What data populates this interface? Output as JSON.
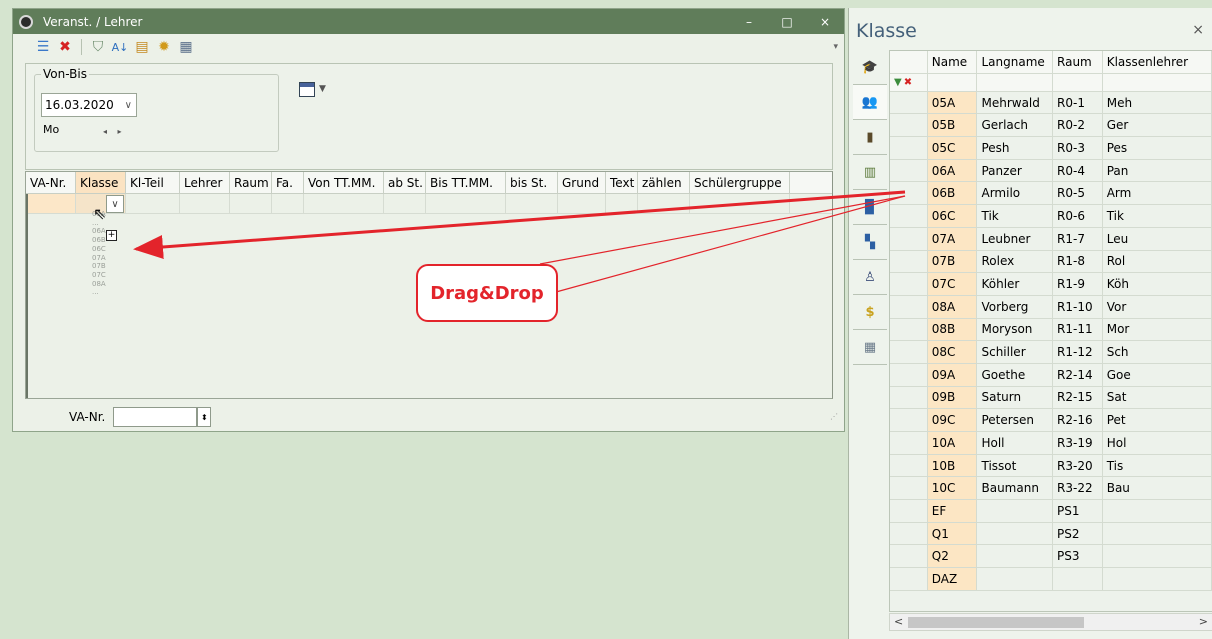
{
  "window": {
    "title": "Veranst. / Lehrer",
    "controls": {
      "minimize": "–",
      "maximize": "□",
      "close": "×"
    }
  },
  "toolbar": {
    "icons": [
      "list-icon",
      "delete-icon",
      "filter-icon",
      "sort-icon",
      "report-icon",
      "settings-icon",
      "calendar-icon"
    ],
    "more": "▾"
  },
  "filter": {
    "group_label": "Von-Bis",
    "date": "16.03.2020",
    "day": "Mo",
    "date_dropdown": "∨",
    "spin": "◂ ▸"
  },
  "grid": {
    "columns": [
      "VA-Nr.",
      "Klasse",
      "Kl-Teil",
      "Lehrer",
      "Raum",
      "Fa.",
      "Von TT.MM.",
      "ab St.",
      "Bis TT.MM.",
      "bis St.",
      "Grund",
      "Text",
      "zählen",
      "Schülergruppe"
    ],
    "combo_glyph": "∨",
    "drag_ghost": [
      "05A",
      "...",
      "06A",
      "06B",
      "06C",
      "07A",
      "07B",
      "07C",
      "08A",
      "..."
    ],
    "drop_glyph": "+"
  },
  "footer": {
    "label": "VA-Nr.",
    "value": ""
  },
  "panel": {
    "title": "Klasse",
    "close": "×",
    "tab_icons": [
      "mortarboard-icon",
      "people-icon",
      "door-icon",
      "subject-icon",
      "book-icon",
      "rooms-icon",
      "teacher-icon",
      "money-icon",
      "timetable-icon"
    ],
    "columns": [
      "Name",
      "Langname",
      "Raum",
      "Klassenlehrer"
    ],
    "rows": [
      [
        "05A",
        "Mehrwald",
        "R0-1",
        "Meh"
      ],
      [
        "05B",
        "Gerlach",
        "R0-2",
        "Ger"
      ],
      [
        "05C",
        "Pesh",
        "R0-3",
        "Pes"
      ],
      [
        "06A",
        "Panzer",
        "R0-4",
        "Pan"
      ],
      [
        "06B",
        "Armilo",
        "R0-5",
        "Arm"
      ],
      [
        "06C",
        "Tik",
        "R0-6",
        "Tik"
      ],
      [
        "07A",
        "Leubner",
        "R1-7",
        "Leu"
      ],
      [
        "07B",
        "Rolex",
        "R1-8",
        "Rol"
      ],
      [
        "07C",
        "Köhler",
        "R1-9",
        "Köh"
      ],
      [
        "08A",
        "Vorberg",
        "R1-10",
        "Vor"
      ],
      [
        "08B",
        "Moryson",
        "R1-11",
        "Mor"
      ],
      [
        "08C",
        "Schiller",
        "R1-12",
        "Sch"
      ],
      [
        "09A",
        "Goethe",
        "R2-14",
        "Goe"
      ],
      [
        "09B",
        "Saturn",
        "R2-15",
        "Sat"
      ],
      [
        "09C",
        "Petersen",
        "R2-16",
        "Pet"
      ],
      [
        "10A",
        "Holl",
        "R3-19",
        "Hol"
      ],
      [
        "10B",
        "Tissot",
        "R3-20",
        "Tis"
      ],
      [
        "10C",
        "Baumann",
        "R3-22",
        "Bau"
      ],
      [
        "EF",
        "",
        "PS1",
        ""
      ],
      [
        "Q1",
        "",
        "PS2",
        ""
      ],
      [
        "Q2",
        "",
        "PS3",
        ""
      ],
      [
        "DAZ",
        "",
        "",
        ""
      ]
    ],
    "scroll": {
      "left": "<",
      "right": ">"
    }
  },
  "annotation": {
    "label": "Drag&Drop",
    "color": "#e3242b"
  }
}
